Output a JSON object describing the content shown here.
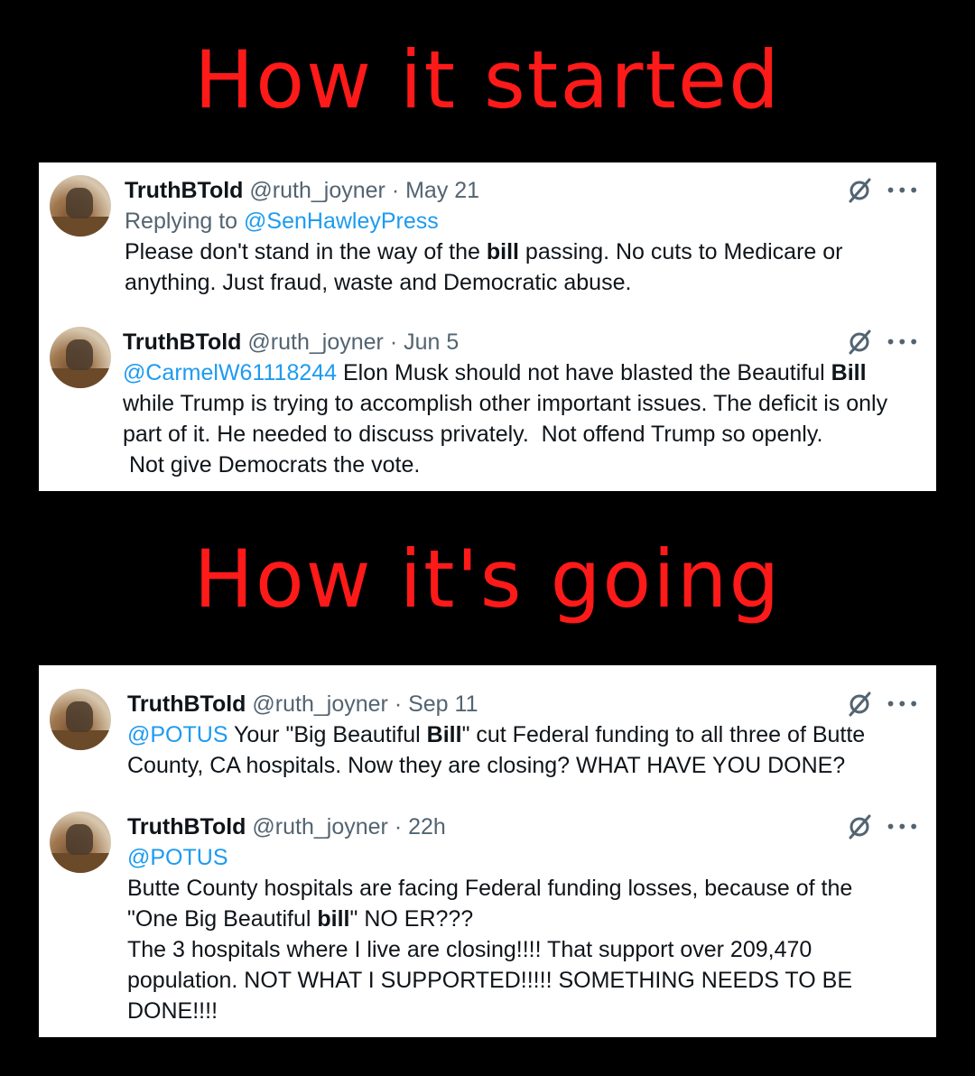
{
  "headings": {
    "top": "How it started",
    "bottom": "How it's going"
  },
  "colors": {
    "heading": "#ff1a1a",
    "link": "#1d9bf0",
    "meta": "#536471"
  },
  "tweets": [
    {
      "name": "TruthBTold",
      "handle": "@ruth_joyner",
      "sep": "·",
      "date": "May 21",
      "reply_prefix": "Replying to ",
      "reply_to": "@SenHawleyPress",
      "parts": [
        "Please don't stand in the way of the ",
        "bill",
        " passing. No cuts to Medicare or anything. Just fraud, waste and Democratic abuse."
      ],
      "icons": [
        "grok-icon",
        "more-icon"
      ]
    },
    {
      "name": "TruthBTold",
      "handle": "@ruth_joyner",
      "sep": "·",
      "date": "Jun 5",
      "mention": "@CarmelW61118244",
      "parts": [
        " Elon Musk should not have blasted the Beautiful ",
        "Bill",
        " while Trump is trying to accomplish other important issues. The deficit is only part of it. He needed to discuss privately.  Not offend Trump so openly.\n Not give Democrats the vote."
      ],
      "icons": [
        "grok-icon",
        "more-icon"
      ]
    },
    {
      "name": "TruthBTold",
      "handle": "@ruth_joyner",
      "sep": "·",
      "date": "Sep 11",
      "mention": "@POTUS",
      "parts": [
        " Your \"Big Beautiful ",
        "Bill",
        "\" cut Federal funding to all three of Butte County, CA hospitals. Now they are closing? WHAT HAVE YOU DONE?"
      ],
      "icons": [
        "grok-icon",
        "more-icon"
      ]
    },
    {
      "name": "TruthBTold",
      "handle": "@ruth_joyner",
      "sep": "·",
      "date": "22h",
      "mention": "@POTUS",
      "parts": [
        "\nButte County hospitals are facing Federal funding losses, because of the \"One Big Beautiful ",
        "bill",
        "\" NO ER???\nThe 3 hospitals where I live are closing!!!! That support over 209,470 population. NOT WHAT I SUPPORTED!!!!! SOMETHING NEEDS TO BE DONE!!!!"
      ],
      "icons": [
        "grok-icon",
        "more-icon"
      ]
    }
  ],
  "more_glyph": "•••"
}
